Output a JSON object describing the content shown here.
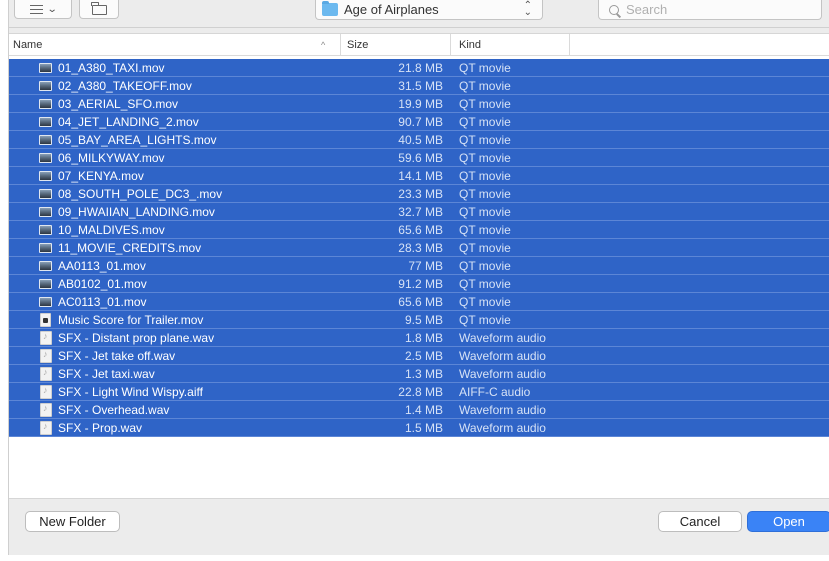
{
  "toolbar": {
    "view_icon": "list-view-icon",
    "new_folder_icon": "folder-outline-icon",
    "location": "Age of Airplanes",
    "search_placeholder": "Search"
  },
  "columns": {
    "name": "Name",
    "size": "Size",
    "kind": "Kind",
    "sort_indicator": "^"
  },
  "files": [
    {
      "name": "01_A380_TAXI.mov",
      "size": "21.8 MB",
      "kind": "QT movie",
      "icon": "movie"
    },
    {
      "name": "02_A380_TAKEOFF.mov",
      "size": "31.5 MB",
      "kind": "QT movie",
      "icon": "movie"
    },
    {
      "name": "03_AERIAL_SFO.mov",
      "size": "19.9 MB",
      "kind": "QT movie",
      "icon": "movie"
    },
    {
      "name": "04_JET_LANDING_2.mov",
      "size": "90.7 MB",
      "kind": "QT movie",
      "icon": "movie"
    },
    {
      "name": "05_BAY_AREA_LIGHTS.mov",
      "size": "40.5 MB",
      "kind": "QT movie",
      "icon": "movie"
    },
    {
      "name": "06_MILKYWAY.mov",
      "size": "59.6 MB",
      "kind": "QT movie",
      "icon": "movie"
    },
    {
      "name": "07_KENYA.mov",
      "size": "14.1 MB",
      "kind": "QT movie",
      "icon": "movie"
    },
    {
      "name": "08_SOUTH_POLE_DC3_.mov",
      "size": "23.3 MB",
      "kind": "QT movie",
      "icon": "movie"
    },
    {
      "name": "09_HWAIIAN_LANDING.mov",
      "size": "32.7 MB",
      "kind": "QT movie",
      "icon": "movie"
    },
    {
      "name": "10_MALDIVES.mov",
      "size": "65.6 MB",
      "kind": "QT movie",
      "icon": "movie"
    },
    {
      "name": "11_MOVIE_CREDITS.mov",
      "size": "28.3 MB",
      "kind": "QT movie",
      "icon": "movie"
    },
    {
      "name": "AA0113_01.mov",
      "size": "77 MB",
      "kind": "QT movie",
      "icon": "movie"
    },
    {
      "name": "AB0102_01.mov",
      "size": "91.2 MB",
      "kind": "QT movie",
      "icon": "movie"
    },
    {
      "name": "AC0113_01.mov",
      "size": "65.6 MB",
      "kind": "QT movie",
      "icon": "movie"
    },
    {
      "name": "Music Score for Trailer.mov",
      "size": "9.5 MB",
      "kind": "QT movie",
      "icon": "doc"
    },
    {
      "name": "SFX - Distant prop plane.wav",
      "size": "1.8 MB",
      "kind": "Waveform audio",
      "icon": "audio"
    },
    {
      "name": "SFX - Jet take off.wav",
      "size": "2.5 MB",
      "kind": "Waveform audio",
      "icon": "audio"
    },
    {
      "name": "SFX - Jet taxi.wav",
      "size": "1.3 MB",
      "kind": "Waveform audio",
      "icon": "audio"
    },
    {
      "name": "SFX - Light Wind Wispy.aiff",
      "size": "22.8 MB",
      "kind": "AIFF-C audio",
      "icon": "audio"
    },
    {
      "name": "SFX - Overhead.wav",
      "size": "1.4 MB",
      "kind": "Waveform audio",
      "icon": "audio"
    },
    {
      "name": "SFX - Prop.wav",
      "size": "1.5 MB",
      "kind": "Waveform audio",
      "icon": "audio"
    }
  ],
  "footer": {
    "new_folder_label": "New Folder",
    "cancel_label": "Cancel",
    "open_label": "Open"
  },
  "colors": {
    "selection": "#2f64c7",
    "accent_button": "#3a83f6"
  }
}
